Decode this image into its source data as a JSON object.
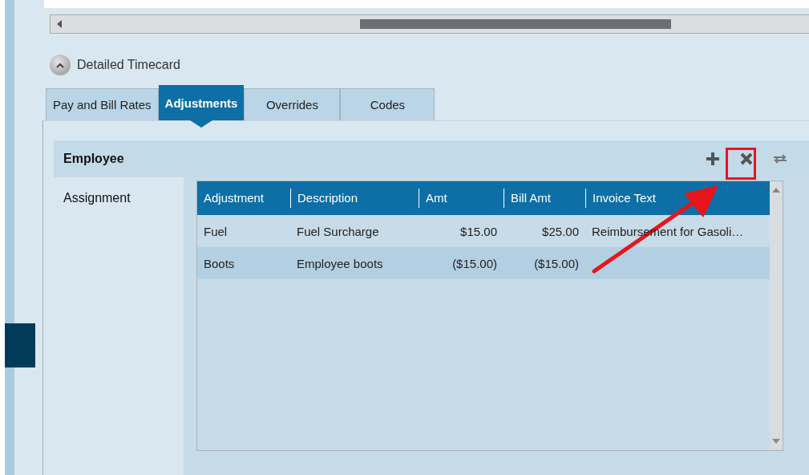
{
  "section": {
    "title": "Detailed Timecard"
  },
  "tabs": [
    {
      "label": "Pay and Bill Rates",
      "selected": false
    },
    {
      "label": "Adjustments",
      "selected": true
    },
    {
      "label": "Overrides",
      "selected": false
    },
    {
      "label": "Codes",
      "selected": false
    }
  ],
  "sidebar": {
    "items": [
      {
        "label": "Employee",
        "selected": true
      },
      {
        "label": "Assignment",
        "selected": false
      }
    ]
  },
  "table": {
    "columns": [
      {
        "label": "Adjustment"
      },
      {
        "label": "Description"
      },
      {
        "label": "Amt"
      },
      {
        "label": "Bill Amt"
      },
      {
        "label": "Invoice Text"
      }
    ],
    "rows": [
      {
        "cells": [
          "Fuel",
          "Fuel Surcharge",
          "$15.00",
          "$25.00",
          "Reimbursement for Gasoli…"
        ],
        "selected": false
      },
      {
        "cells": [
          "Boots",
          "Employee boots",
          "($15.00)",
          "($15.00)"
        ],
        "selected": true
      }
    ]
  }
}
